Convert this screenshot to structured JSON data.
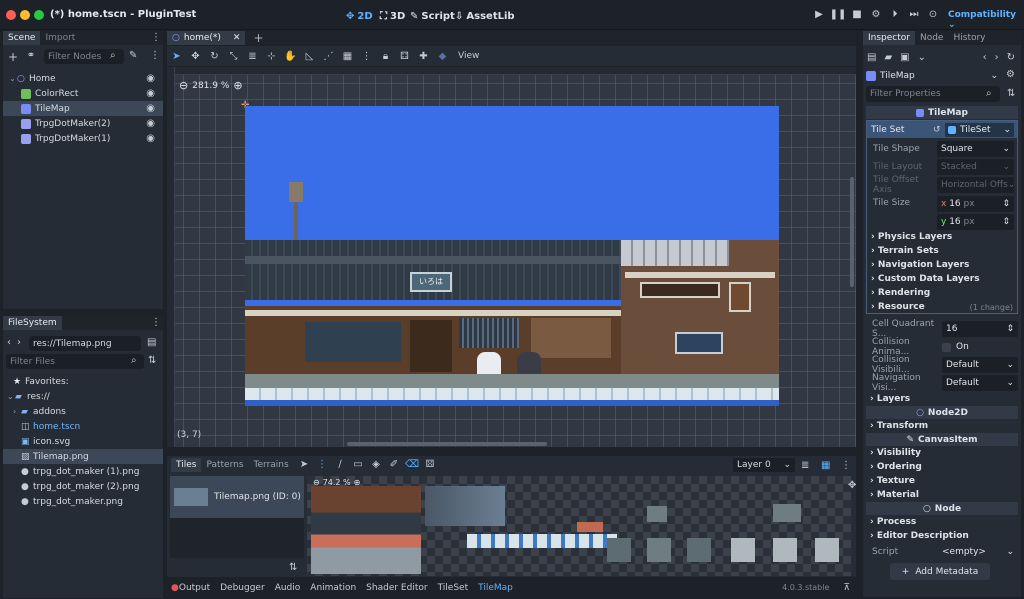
{
  "window": {
    "title": "(*) home.tscn - PluginTest"
  },
  "topbar": {
    "btn_2d": "2D",
    "btn_3d": "3D",
    "btn_script": "Script",
    "btn_assetlib": "AssetLib",
    "renderer": "Compatibility"
  },
  "scene_dock": {
    "tab_scene": "Scene",
    "tab_import": "Import",
    "filter_placeholder": "Filter Nodes",
    "nodes": [
      {
        "name": "Home",
        "kind": "node2d"
      },
      {
        "name": "ColorRect",
        "kind": "colorrect"
      },
      {
        "name": "TileMap",
        "kind": "tilemap"
      },
      {
        "name": "TrpgDotMaker(2)",
        "kind": "plugin"
      },
      {
        "name": "TrpgDotMaker(1)",
        "kind": "plugin"
      }
    ]
  },
  "filesystem": {
    "tab": "FileSystem",
    "path": "res://Tilemap.png",
    "filter_placeholder": "Filter Files",
    "favorites": "Favorites:",
    "root": "res://",
    "items": [
      {
        "name": "addons",
        "kind": "folder"
      },
      {
        "name": "home.tscn",
        "kind": "scene"
      },
      {
        "name": "icon.svg",
        "kind": "image"
      },
      {
        "name": "Tilemap.png",
        "kind": "image"
      },
      {
        "name": "trpg_dot_maker (1).png",
        "kind": "gdicon"
      },
      {
        "name": "trpg_dot_maker (2).png",
        "kind": "gdicon"
      },
      {
        "name": "trpg_dot_maker.png",
        "kind": "gdicon"
      }
    ]
  },
  "editor": {
    "tab": "home(*)",
    "view_menu": "View",
    "zoom": "281.9 %",
    "coords": "(3, 7)",
    "sign": "いろは"
  },
  "tilemap_panel": {
    "tab_tiles": "Tiles",
    "tab_patterns": "Patterns",
    "tab_terrains": "Terrains",
    "layer": "Layer 0",
    "atlas_item": "Tilemap.png (ID: 0)",
    "atlas_zoom": "74.2 %"
  },
  "bottom_bar": {
    "tabs": [
      "Output",
      "Debugger",
      "Audio",
      "Animation",
      "Shader Editor",
      "TileSet",
      "TileMap"
    ],
    "version": "4.0.3.stable"
  },
  "inspector": {
    "tab_inspector": "Inspector",
    "tab_node": "Node",
    "tab_history": "History",
    "object": "TileMap",
    "filter_placeholder": "Filter Properties",
    "class_tilemap": "TileMap",
    "tileset_label": "Tile Set",
    "tileset_value": "TileSet",
    "tile_shape": {
      "label": "Tile Shape",
      "value": "Square"
    },
    "tile_layout": {
      "label": "Tile Layout",
      "value": "Stacked"
    },
    "tile_offset_axis": {
      "label": "Tile Offset Axis",
      "value": "Horizontal Offs"
    },
    "tile_size": {
      "label": "Tile Size",
      "x_label": "x",
      "x": "16",
      "y_label": "y",
      "y": "16",
      "unit": "px"
    },
    "sub_sections": [
      "Physics Layers",
      "Terrain Sets",
      "Navigation Layers",
      "Custom Data Layers",
      "Rendering"
    ],
    "resource": {
      "label": "Resource",
      "note": "(1 change)"
    },
    "cell_quadrant": {
      "label": "Cell Quadrant S...",
      "value": "16"
    },
    "collision_anim": {
      "label": "Collision Anima...",
      "value": "On"
    },
    "collision_vis": {
      "label": "Collision Visibili...",
      "value": "Default"
    },
    "navigation_vis": {
      "label": "Navigation Visi...",
      "value": "Default"
    },
    "layers": "Layers",
    "class_node2d": "Node2D",
    "transform": "Transform",
    "class_canvasitem": "CanvasItem",
    "canvas_sections": [
      "Visibility",
      "Ordering",
      "Texture",
      "Material"
    ],
    "class_node": "Node",
    "process": "Process",
    "editor_description": "Editor Description",
    "script": {
      "label": "Script",
      "value": "<empty>"
    },
    "add_metadata": "Add Metadata"
  },
  "colors": {
    "accent": "#5fb2ff",
    "panel": "#262c35",
    "bg": "#1d2229",
    "sky": "#3a6ee8"
  }
}
